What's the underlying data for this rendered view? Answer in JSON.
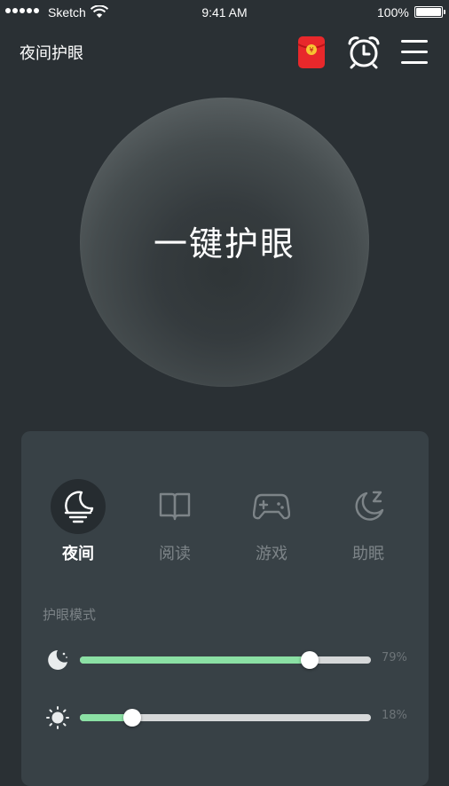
{
  "status_bar": {
    "carrier": "Sketch",
    "time": "9:41 AM",
    "battery": "100%"
  },
  "header": {
    "title": "夜间护眼",
    "icons": [
      "red-packet-icon",
      "alarm-clock-icon",
      "menu-icon"
    ],
    "red_packet_color": "#e8282b"
  },
  "main_button": {
    "label": "一键护眼"
  },
  "modes": [
    {
      "label": "夜间",
      "icon": "night-icon",
      "active": true
    },
    {
      "label": "阅读",
      "icon": "book-icon",
      "active": false
    },
    {
      "label": "游戏",
      "icon": "gamepad-icon",
      "active": false
    },
    {
      "label": "助眠",
      "icon": "sleep-icon",
      "active": false
    }
  ],
  "eye_mode": {
    "section_label": "护眼模式",
    "sliders": [
      {
        "name": "filter",
        "icon": "moon-icon",
        "value": 0.79,
        "label": "79%"
      },
      {
        "name": "brightness",
        "icon": "sun-icon",
        "value": 0.18,
        "label": "18%"
      }
    ]
  },
  "colors": {
    "background": "#2a3034",
    "panel": "#384146",
    "accent_green": "#8be0a4",
    "inactive_text": "#7d8488"
  }
}
